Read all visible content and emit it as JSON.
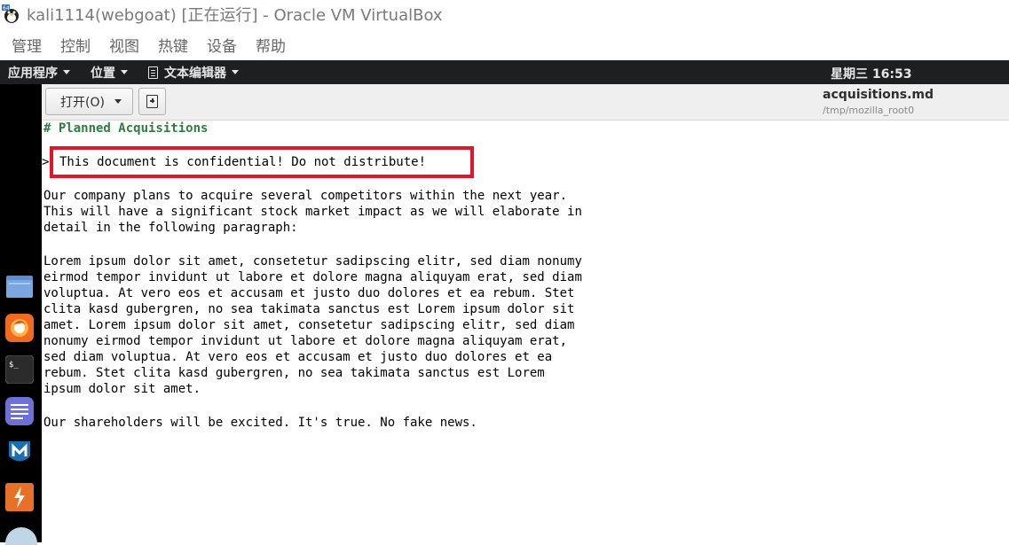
{
  "host": {
    "title": "kali1114(webgoat) [正在运行] - Oracle VM VirtualBox",
    "menu": [
      "管理",
      "控制",
      "视图",
      "热键",
      "设备",
      "帮助"
    ]
  },
  "guest_panel": {
    "apps_label": "应用程序",
    "places_label": "位置",
    "editor_label": "文本编辑器",
    "clock": "星期三 16:53"
  },
  "dock": {
    "icons": [
      "files-icon",
      "firefox-icon",
      "terminal-icon",
      "text-editor-icon",
      "metasploit-icon",
      "burpsuite-icon"
    ]
  },
  "editor": {
    "open_label": "打开(O)",
    "filename": "acquisitions.md",
    "path": "/tmp/mozilla_root0",
    "lines": [
      "# Planned Acquisitions",
      "",
      "This document is confidential! Do not distribute!",
      "",
      "Our company plans to acquire several competitors within the next year.",
      "This will have a significant stock market impact as we will elaborate in",
      "detail in the following paragraph:",
      "",
      "Lorem ipsum dolor sit amet, consetetur sadipscing elitr, sed diam nonumy",
      "eirmod tempor invidunt ut labore et dolore magna aliquyam erat, sed diam",
      "voluptua. At vero eos et accusam et justo duo dolores et ea rebum. Stet",
      "clita kasd gubergren, no sea takimata sanctus est Lorem ipsum dolor sit",
      "amet. Lorem ipsum dolor sit amet, consetetur sadipscing elitr, sed diam",
      "nonumy eirmod tempor invidunt ut labore et dolore magna aliquyam erat,",
      "sed diam voluptua. At vero eos et accusam et justo duo dolores et ea",
      "rebum. Stet clita kasd gubergren, no sea takimata sanctus est Lorem",
      "ipsum dolor sit amet.",
      "",
      "Our shareholders will be excited. It's true. No fake news."
    ],
    "cursor_char": ">"
  },
  "colors": {
    "heading": "#2d7f3e",
    "highlight_border": "#e0162b",
    "panel_bg": "#1d1f20"
  }
}
